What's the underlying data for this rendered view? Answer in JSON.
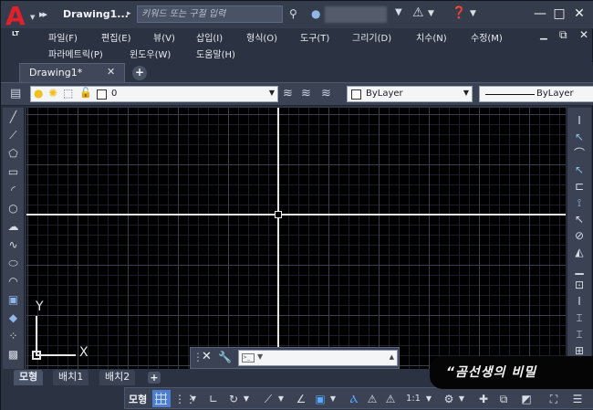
{
  "app": {
    "logo_text": "A",
    "edition": "LT",
    "document_title": "Drawing1...",
    "search_placeholder": "키워드 또는 구절 입력"
  },
  "menu": {
    "row1": [
      "파일(F)",
      "편집(E)",
      "뷰(V)",
      "삽입(I)",
      "형식(O)",
      "도구(T)",
      "그리기(D)",
      "치수(N)",
      "수정(M)"
    ],
    "row2": [
      "파라메트릭(P)",
      "윈도우(W)",
      "도움말(H)"
    ]
  },
  "file_tabs": {
    "active": "Drawing1*",
    "close_glyph": "✕",
    "add_glyph": "+"
  },
  "properties": {
    "layer_name": "0",
    "color": "ByLayer",
    "linetype": "ByLayer"
  },
  "ucs": {
    "x_label": "X",
    "y_label": "Y"
  },
  "layout_tabs": [
    "모형",
    "배치1",
    "배치2"
  ],
  "status": {
    "model_label": "모형",
    "scale": "1:1"
  },
  "watermark": "“곰선생의 비밀",
  "colors": {
    "accent_red": "#e0202a",
    "canvas_bg": "#000000",
    "chrome_bg": "#2b3242",
    "status_active": "#5aa8ff"
  },
  "icons": {
    "left_toolbar": [
      "line-icon",
      "polyline-icon",
      "polygon-icon",
      "rectangle-icon",
      "arc-icon",
      "circle-icon",
      "revcloud-icon",
      "spline-icon",
      "ellipse-icon",
      "insert-block-icon",
      "make-block-icon",
      "point-icon",
      "hatch-icon"
    ],
    "right_toolbar": [
      "erase-icon",
      "copy-icon",
      "mirror-icon",
      "offset-icon",
      "array-icon",
      "move-icon",
      "rotate-icon",
      "scale-icon",
      "stretch-icon",
      "trim-icon",
      "extend-icon",
      "break-icon",
      "join-icon",
      "chamfer-icon",
      "fillet-icon",
      "explode-icon"
    ]
  }
}
